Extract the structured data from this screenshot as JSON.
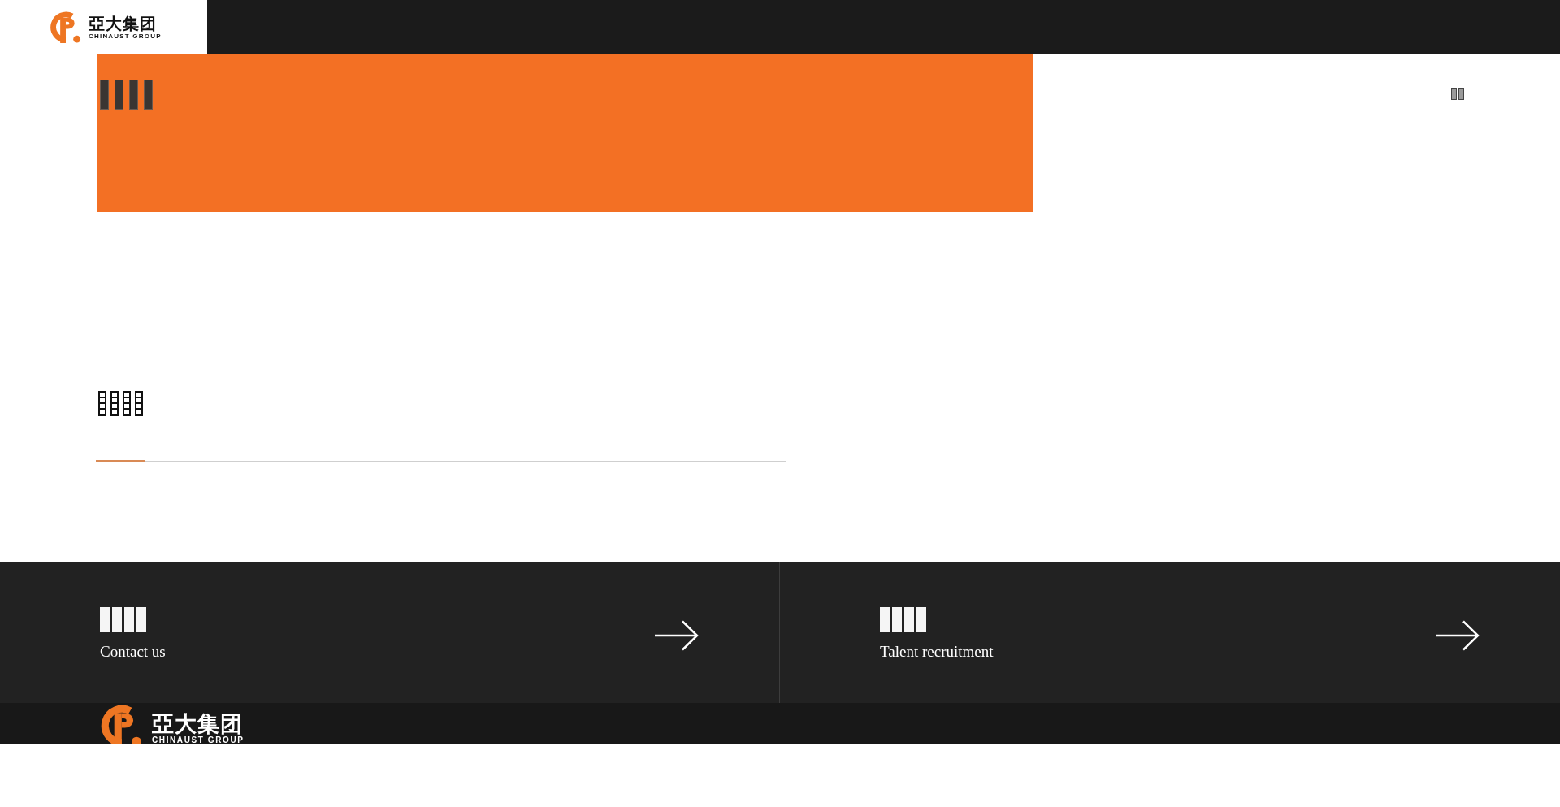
{
  "header": {
    "logo": {
      "name": "亞大集团",
      "tagline": "CHINAUST GROUP"
    },
    "menu_glyphs": [
      {
        "kind": "missing_glyph"
      },
      {
        "kind": "missing_glyph"
      }
    ]
  },
  "banner": {
    "title_glyphs": [
      {
        "kind": "missing_glyph"
      },
      {
        "kind": "missing_glyph"
      },
      {
        "kind": "missing_glyph"
      },
      {
        "kind": "missing_glyph"
      }
    ]
  },
  "section": {
    "heading_glyphs": [
      {
        "kind": "missing_glyph"
      },
      {
        "kind": "missing_glyph"
      },
      {
        "kind": "missing_glyph"
      },
      {
        "kind": "missing_glyph"
      }
    ]
  },
  "links": [
    {
      "glyphs": [
        {
          "kind": "missing_glyph"
        },
        {
          "kind": "missing_glyph"
        },
        {
          "kind": "missing_glyph"
        },
        {
          "kind": "missing_glyph"
        }
      ],
      "label": "Contact us"
    },
    {
      "glyphs": [
        {
          "kind": "missing_glyph"
        },
        {
          "kind": "missing_glyph"
        },
        {
          "kind": "missing_glyph"
        },
        {
          "kind": "missing_glyph"
        }
      ],
      "label": "Talent recruitment"
    }
  ],
  "footer": {
    "logo": {
      "name": "亞大集团",
      "tagline": "CHINAUST GROUP"
    }
  }
}
